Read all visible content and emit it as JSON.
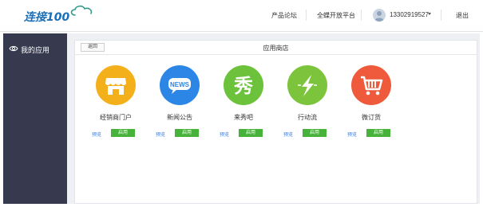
{
  "header": {
    "logo_text": "连接100",
    "links": [
      "产品论坛",
      "全蝶开放平台"
    ],
    "username": "13302919527",
    "logout": "退出"
  },
  "sidebar": {
    "items": [
      {
        "label": "我的应用",
        "icon": "eye-icon"
      }
    ]
  },
  "main": {
    "back_label": "返回",
    "title": "应用商店",
    "preview_label": "预览",
    "enable_label": "启用",
    "apps": [
      {
        "name": "经销商门户",
        "icon": "shop-icon",
        "color": "#f3b01b"
      },
      {
        "name": "新闻公告",
        "icon": "news-bubble-icon",
        "icon_text": "NEWS",
        "color": "#2b86e6"
      },
      {
        "name": "来秀吧",
        "icon": "show-icon",
        "icon_text": "秀",
        "color": "#6cc23a"
      },
      {
        "name": "行动流",
        "icon": "lightning-icon",
        "color": "#7cc43c"
      },
      {
        "name": "微订货",
        "icon": "cart-icon",
        "color": "#ef5a3c"
      }
    ]
  },
  "colors": {
    "brand": "#1a6fb8",
    "sidebar_bg": "#373a4f",
    "enable_green": "#46b239",
    "link_blue": "#3a7bd5"
  }
}
